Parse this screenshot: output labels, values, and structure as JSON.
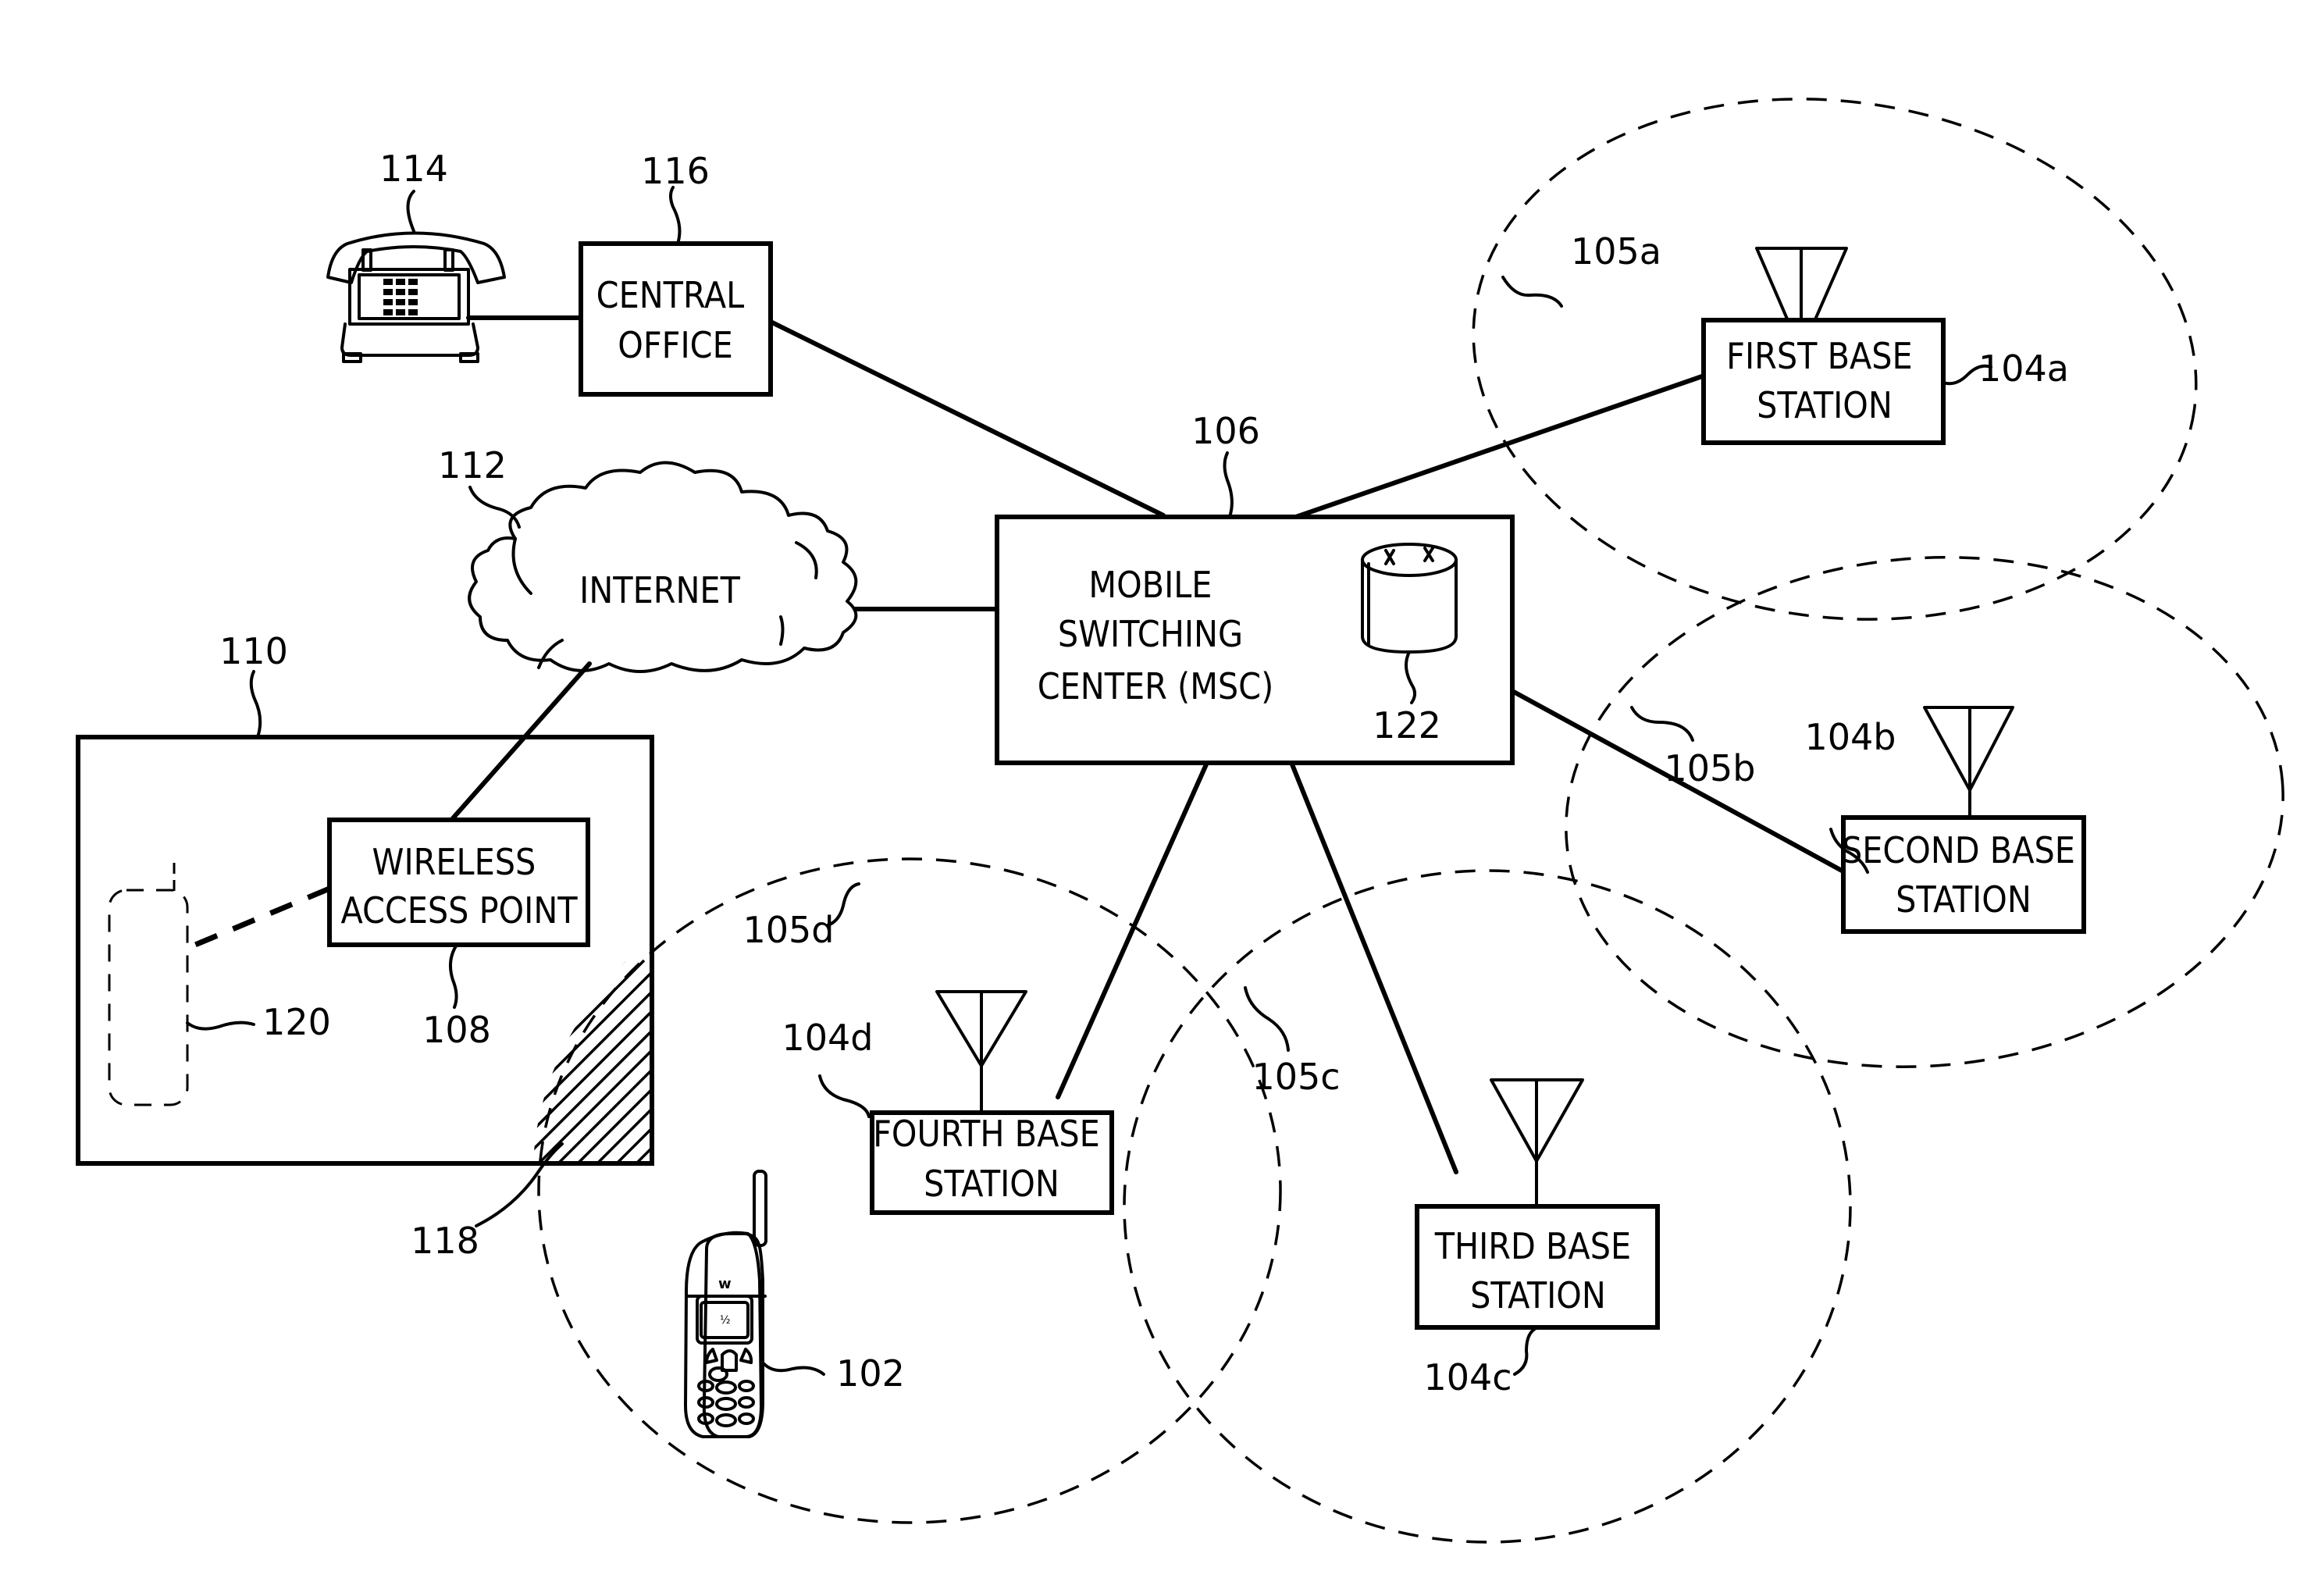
{
  "figure": {
    "nodes": {
      "telephone": {
        "ref": "114"
      },
      "central_office": {
        "ref": "116",
        "lines": [
          "CENTRAL",
          "OFFICE"
        ]
      },
      "internet": {
        "ref": "112",
        "label": "INTERNET"
      },
      "msc": {
        "ref": "106",
        "lines": [
          "MOBILE",
          "SWITCHING",
          "CENTER (MSC)"
        ],
        "database_ref": "122"
      },
      "first_base_station": {
        "ref": "104a",
        "coverage_ref": "105a",
        "lines": [
          "FIRST BASE",
          "STATION"
        ]
      },
      "second_base_station": {
        "ref": "104b",
        "coverage_ref": "105b",
        "lines": [
          "SECOND BASE",
          "STATION"
        ]
      },
      "third_base_station": {
        "ref": "104c",
        "coverage_ref": "105c",
        "lines": [
          "THIRD BASE",
          "STATION"
        ]
      },
      "fourth_base_station": {
        "ref": "104d",
        "coverage_ref": "105d",
        "lines": [
          "FOURTH BASE",
          "STATION"
        ]
      },
      "building": {
        "ref": "110"
      },
      "wireless_access_point": {
        "ref": "108",
        "lines": [
          "WIRELESS",
          "ACCESS POINT"
        ]
      },
      "wlan_device": {
        "ref": "120"
      },
      "overlap_region": {
        "ref": "118"
      },
      "mobile_phone": {
        "ref": "102"
      }
    },
    "connections": [
      {
        "from": "telephone",
        "to": "central_office",
        "style": "solid"
      },
      {
        "from": "central_office",
        "to": "msc",
        "style": "solid"
      },
      {
        "from": "internet",
        "to": "msc",
        "style": "solid"
      },
      {
        "from": "internet",
        "to": "wireless_access_point",
        "style": "solid"
      },
      {
        "from": "msc",
        "to": "first_base_station",
        "style": "solid"
      },
      {
        "from": "msc",
        "to": "second_base_station",
        "style": "solid"
      },
      {
        "from": "msc",
        "to": "third_base_station",
        "style": "solid"
      },
      {
        "from": "msc",
        "to": "fourth_base_station",
        "style": "solid"
      },
      {
        "from": "wireless_access_point",
        "to": "wlan_device",
        "style": "dashed"
      }
    ]
  }
}
